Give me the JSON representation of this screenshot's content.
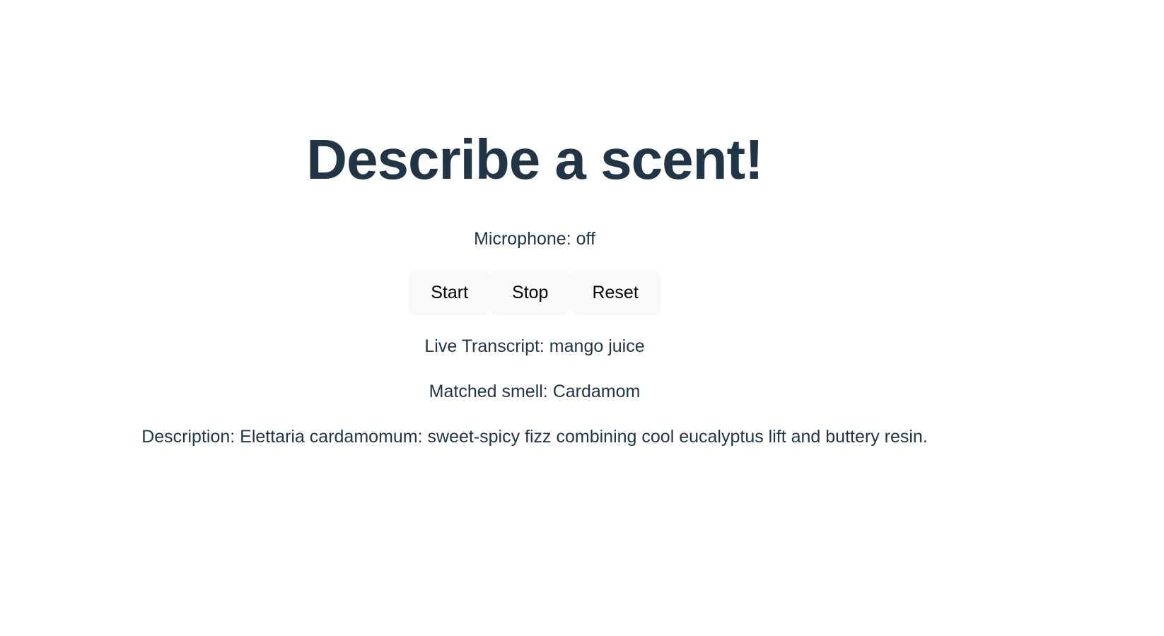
{
  "page": {
    "title": "Describe a scent!"
  },
  "status": {
    "microphone": "Microphone: off"
  },
  "controls": {
    "start_label": "Start",
    "stop_label": "Stop",
    "reset_label": "Reset"
  },
  "results": {
    "transcript": "Live Transcript: mango juice",
    "matched": "Matched smell: Cardamom",
    "description": "Description: Elettaria cardamomum: sweet-spicy fizz combining cool eucalyptus lift and buttery resin."
  },
  "colors": {
    "text": "#213547",
    "button_bg": "#f9f9f9",
    "background": "#ffffff"
  }
}
